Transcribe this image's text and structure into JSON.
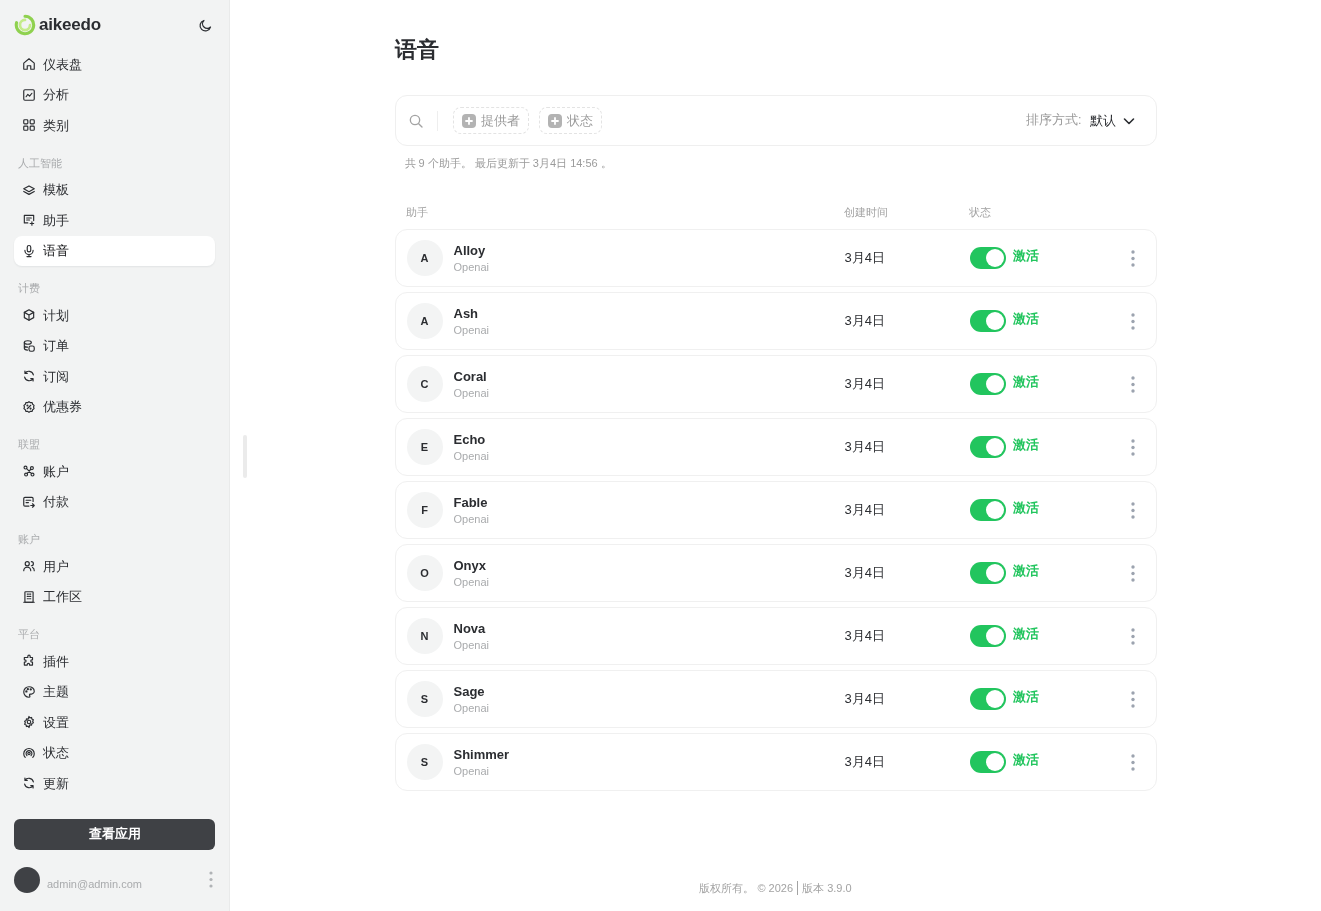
{
  "sidebar": {
    "brand": "aikeedo",
    "sections": [
      {
        "items": [
          {
            "label": "仪表盘",
            "selected": false
          },
          {
            "label": "分析",
            "selected": false
          },
          {
            "label": "类别",
            "selected": false
          }
        ]
      },
      {
        "label": "人工智能",
        "items": [
          {
            "label": "模板",
            "selected": false
          },
          {
            "label": "助手",
            "selected": false
          },
          {
            "label": "语音",
            "selected": true
          }
        ]
      },
      {
        "label": "计费",
        "items": [
          {
            "label": "计划",
            "selected": false
          },
          {
            "label": "订单",
            "selected": false
          },
          {
            "label": "订阅",
            "selected": false
          },
          {
            "label": "优惠券",
            "selected": false
          }
        ]
      },
      {
        "label": "联盟",
        "items": [
          {
            "label": "账户",
            "selected": false
          },
          {
            "label": "付款",
            "selected": false
          }
        ]
      },
      {
        "label": "账户",
        "items": [
          {
            "label": "用户",
            "selected": false
          },
          {
            "label": "工作区",
            "selected": false
          }
        ]
      },
      {
        "label": "平台",
        "items": [
          {
            "label": "插件",
            "selected": false
          },
          {
            "label": "主题",
            "selected": false
          },
          {
            "label": "设置",
            "selected": false
          },
          {
            "label": "状态",
            "selected": false
          },
          {
            "label": "更新",
            "selected": false
          }
        ]
      }
    ],
    "app_button": "查看应用",
    "user": {
      "email": "admin@admin.com"
    }
  },
  "page": {
    "title": "语音"
  },
  "filter_bar": {
    "filters": [
      "提供者",
      "状态"
    ],
    "sort_label": "排序方式:",
    "sort_value": "默认"
  },
  "summary": "共 9 个助手。 最后更新于 3月4日 14:56 。",
  "table": {
    "columns": [
      "助手",
      "创建时间",
      "状态"
    ],
    "rows": [
      {
        "initial": "A",
        "name": "Alloy",
        "provider": "Openai",
        "created": "3月4日",
        "on": true,
        "status": "激活"
      },
      {
        "initial": "A",
        "name": "Ash",
        "provider": "Openai",
        "created": "3月4日",
        "on": true,
        "status": "激活"
      },
      {
        "initial": "C",
        "name": "Coral",
        "provider": "Openai",
        "created": "3月4日",
        "on": true,
        "status": "激活"
      },
      {
        "initial": "E",
        "name": "Echo",
        "provider": "Openai",
        "created": "3月4日",
        "on": true,
        "status": "激活"
      },
      {
        "initial": "F",
        "name": "Fable",
        "provider": "Openai",
        "created": "3月4日",
        "on": true,
        "status": "激活"
      },
      {
        "initial": "O",
        "name": "Onyx",
        "provider": "Openai",
        "created": "3月4日",
        "on": true,
        "status": "激活"
      },
      {
        "initial": "N",
        "name": "Nova",
        "provider": "Openai",
        "created": "3月4日",
        "on": true,
        "status": "激活"
      },
      {
        "initial": "S",
        "name": "Sage",
        "provider": "Openai",
        "created": "3月4日",
        "on": true,
        "status": "激活"
      },
      {
        "initial": "S",
        "name": "Shimmer",
        "provider": "Openai",
        "created": "3月4日",
        "on": true,
        "status": "激活"
      }
    ]
  },
  "footer": {
    "copyright": "版权所有。 © 2026",
    "version": "版本 3.9.0"
  }
}
